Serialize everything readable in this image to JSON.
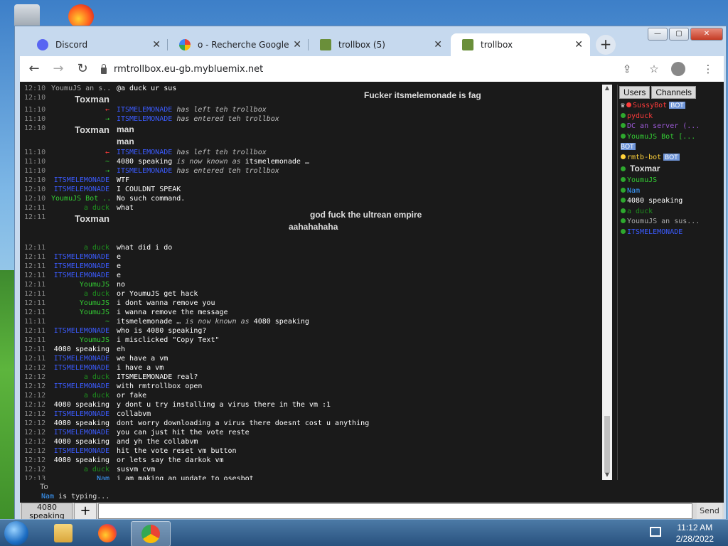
{
  "browser": {
    "tabs": [
      {
        "title": "Discord",
        "icon": "discord-icon",
        "active": false
      },
      {
        "title": "o - Recherche Google",
        "icon": "google-icon",
        "active": false
      },
      {
        "title": "trollbox (5)",
        "icon": "trollbox-icon",
        "active": false
      },
      {
        "title": "trollbox",
        "icon": "trollbox-icon",
        "active": true
      }
    ],
    "new_tab": "+",
    "url": "rmtrollbox.eu-gb.mybluemix.net",
    "controls": {
      "minimize": "—",
      "maximize": "▢",
      "close": "✕"
    }
  },
  "chat": {
    "messages": [
      {
        "time": "12:10",
        "nick": "YoumuJS an s...",
        "nick_color": "#aaaaaa",
        "text": "@a duck ur sus"
      },
      {
        "time": "12:10",
        "nick": "Toxman",
        "nick_color": "#dddddd",
        "nick_bold": true,
        "text": ""
      },
      {
        "time": "11:10",
        "nick": "←",
        "nick_color": "#ff3b3b",
        "text": "",
        "sys_name": "ITSMELEMONADE",
        "sys_text": "has left teh trollbox"
      },
      {
        "time": "11:10",
        "nick": "→",
        "nick_color": "#33cc33",
        "text": "",
        "sys_name": "ITSMELEMONADE",
        "sys_text": "has entered teh trollbox"
      },
      {
        "time": "12:10",
        "nick": "Toxman",
        "nick_color": "#dddddd",
        "nick_bold": true,
        "text": "man",
        "text_bold": true
      },
      {
        "time": "",
        "nick": "",
        "nick_color": "#dddddd",
        "text": "man",
        "text_bold": true
      },
      {
        "time": "11:10",
        "nick": "←",
        "nick_color": "#ff3b3b",
        "text": "",
        "sys_name": "ITSMELEMONADE",
        "sys_text": "has left teh trollbox"
      },
      {
        "time": "11:10",
        "nick": "~",
        "nick_color": "#33cc33",
        "text": "",
        "sys_name": "4080 speaking",
        "sys_name_color": "#ffffff",
        "sys_text": "is now known as",
        "sys_after": "itsmelemonade …"
      },
      {
        "time": "11:10",
        "nick": "→",
        "nick_color": "#33cc33",
        "text": "",
        "sys_name": "ITSMELEMONADE",
        "sys_text": "has entered teh trollbox"
      },
      {
        "time": "12:10",
        "nick": "ITSMELEMONADE",
        "nick_color": "#3b5bff",
        "text": "WTF"
      },
      {
        "time": "12:10",
        "nick": "ITSMELEMONADE",
        "nick_color": "#3b5bff",
        "text": "I COULDNT SPEAK"
      },
      {
        "time": "12:10",
        "nick": "YoumuJS Bot ...",
        "nick_color": "#33cc33",
        "text": "No such command."
      },
      {
        "time": "12:11",
        "nick": "a duck",
        "nick_color": "#1e8f1e",
        "text": "what"
      },
      {
        "time": "12:11",
        "nick": "Toxman",
        "nick_color": "#dddddd",
        "nick_bold": true,
        "text": ""
      },
      {
        "time": "",
        "nick": "",
        "nick_color": "#dddddd",
        "text": ""
      },
      {
        "time": "",
        "nick": "",
        "nick_color": "#dddddd",
        "text": ""
      },
      {
        "time": "12:11",
        "nick": "a duck",
        "nick_color": "#1e8f1e",
        "text": "what did i do"
      },
      {
        "time": "12:11",
        "nick": "ITSMELEMONADE",
        "nick_color": "#3b5bff",
        "text": "e"
      },
      {
        "time": "12:11",
        "nick": "ITSMELEMONADE",
        "nick_color": "#3b5bff",
        "text": "e"
      },
      {
        "time": "12:11",
        "nick": "ITSMELEMONADE",
        "nick_color": "#3b5bff",
        "text": "e"
      },
      {
        "time": "12:11",
        "nick": "YoumuJS",
        "nick_color": "#33cc33",
        "text": "no"
      },
      {
        "time": "12:11",
        "nick": "a duck",
        "nick_color": "#1e8f1e",
        "text": "or YoumuJS get hack"
      },
      {
        "time": "12:11",
        "nick": "YoumuJS",
        "nick_color": "#33cc33",
        "text": "i dont wanna remove you"
      },
      {
        "time": "12:11",
        "nick": "YoumuJS",
        "nick_color": "#33cc33",
        "text": "i wanna remove the message"
      },
      {
        "time": "11:11",
        "nick": "~",
        "nick_color": "#33cc33",
        "text": "",
        "sys_name": "itsmelemonade …",
        "sys_name_color": "#ffffff",
        "sys_text": "is now known as",
        "sys_after": "4080 speaking"
      },
      {
        "time": "12:11",
        "nick": "ITSMELEMONADE",
        "nick_color": "#3b5bff",
        "text": "who is 4080 speaking?"
      },
      {
        "time": "12:11",
        "nick": "YoumuJS",
        "nick_color": "#33cc33",
        "text": "i misclicked \"Copy Text\""
      },
      {
        "time": "12:11",
        "nick": "4080 speaking",
        "nick_color": "#ffffff",
        "text": "eh"
      },
      {
        "time": "12:11",
        "nick": "ITSMELEMONADE",
        "nick_color": "#3b5bff",
        "text": "we have a vm"
      },
      {
        "time": "12:12",
        "nick": "ITSMELEMONADE",
        "nick_color": "#3b5bff",
        "text": "i have a vm"
      },
      {
        "time": "12:12",
        "nick": "a duck",
        "nick_color": "#1e8f1e",
        "text": "ITSMELEMONADE real?"
      },
      {
        "time": "12:12",
        "nick": "ITSMELEMONADE",
        "nick_color": "#3b5bff",
        "text": "with rmtrollbox open"
      },
      {
        "time": "12:12",
        "nick": "a duck",
        "nick_color": "#1e8f1e",
        "text": "or fake"
      },
      {
        "time": "12:12",
        "nick": "4080 speaking",
        "nick_color": "#ffffff",
        "text": "y dont u try installing a virus there in the vm :1"
      },
      {
        "time": "12:12",
        "nick": "ITSMELEMONADE",
        "nick_color": "#3b5bff",
        "text": "collabvm"
      },
      {
        "time": "12:12",
        "nick": "4080 speaking",
        "nick_color": "#ffffff",
        "text": "dont worry downloading a virus there doesnt cost u anything"
      },
      {
        "time": "12:12",
        "nick": "ITSMELEMONADE",
        "nick_color": "#3b5bff",
        "text": "you can just hit the vote reste"
      },
      {
        "time": "12:12",
        "nick": "4080 speaking",
        "nick_color": "#ffffff",
        "text": "and yh the collabvm"
      },
      {
        "time": "12:12",
        "nick": "ITSMELEMONADE",
        "nick_color": "#3b5bff",
        "text": "hit the vote reset vm button"
      },
      {
        "time": "12:12",
        "nick": "4080 speaking",
        "nick_color": "#ffffff",
        "text": "or lets say the darkok vm"
      },
      {
        "time": "12:12",
        "nick": "a duck",
        "nick_color": "#1e8f1e",
        "text": "susvm cvm"
      },
      {
        "time": "12:13",
        "nick": "Nam",
        "nick_color": "#3b9bff",
        "text": "i am making an update to osesbot"
      }
    ],
    "big_texts": [
      "Fucker itsmelemonade is fag",
      "god fuck the ultrean empire",
      "aahahahaha"
    ]
  },
  "sidebar": {
    "tabs": [
      "Users",
      "Channels"
    ],
    "users": [
      {
        "name": "SussyBot",
        "color": "#ff3b3b",
        "dot": "#ff3b3b",
        "bot": true,
        "prefix": "♛"
      },
      {
        "name": "pyduck",
        "color": "#ff3b3b",
        "dot": "#2ea82e"
      },
      {
        "name": "DC an server (...",
        "color": "#9b59d6",
        "dot": "#2ea82e"
      },
      {
        "name": "YoumuJS Bot [...",
        "color": "#33cc33",
        "dot": "#2ea82e"
      },
      {
        "name": "",
        "color": "#ffffff",
        "dot": "",
        "bot": true
      },
      {
        "name": "rmtb-bot",
        "color": "#ffd23b",
        "dot": "#ffd23b",
        "bot": true
      },
      {
        "name": "Toxmar",
        "color": "#dddddd",
        "dot": "#2ea82e",
        "bold": true
      },
      {
        "name": "YoumuJS",
        "color": "#33cc33",
        "dot": "#2ea82e"
      },
      {
        "name": "Nam",
        "color": "#3b9bff",
        "dot": "#2ea82e"
      },
      {
        "name": "4080 speaking",
        "color": "#ffffff",
        "dot": "#2ea82e"
      },
      {
        "name": "a duck",
        "color": "#1e8f1e",
        "dot": "#2ea82e"
      },
      {
        "name": "YoumuJS an sus...",
        "color": "#aaaaaa",
        "dot": "#2ea82e"
      },
      {
        "name": "ITSMELEMONADE",
        "color": "#3b5bff",
        "dot": "#2ea82e"
      }
    ],
    "bot_badge": "BOT"
  },
  "composer": {
    "typing_user": "Nam",
    "typing_text": "is typing...",
    "typing_prefix": "To",
    "nick_button": "4080 speaking",
    "plus": "+",
    "send": "Send",
    "input_value": ""
  },
  "taskbar": {
    "time": "11:12 AM",
    "date": "2/28/2022"
  }
}
